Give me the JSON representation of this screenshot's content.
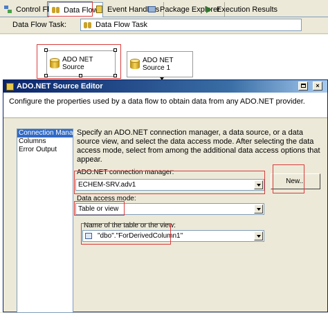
{
  "designer_tabs": [
    {
      "label": "Control Flow",
      "icon": "control-flow-icon"
    },
    {
      "label": "Data Flow",
      "icon": "data-flow-icon",
      "active": true
    },
    {
      "label": "Event Handlers",
      "icon": "event-handlers-icon"
    },
    {
      "label": "Package Explorer",
      "icon": "package-explorer-icon"
    },
    {
      "label": "Execution Results",
      "icon": "execution-results-icon"
    }
  ],
  "task": {
    "label": "Data Flow Task:",
    "selected": "Data Flow Task"
  },
  "components": [
    {
      "line1": "ADO NET",
      "line2": "Source"
    },
    {
      "line1": "ADO NET",
      "line2": "Source 1"
    }
  ],
  "dialog": {
    "title": "ADO.NET Source Editor",
    "description": "Configure the properties used by a data flow to obtain data from any ADO.NET provider.",
    "nav_items": [
      "Connection Manager",
      "Columns",
      "Error Output"
    ],
    "selected_nav": "Connection Manager",
    "instructions": "Specify an ADO.NET connection manager, a data source, or a data source view, and select the data access mode. After selecting the data access mode, select from among the additional data access options that appear.",
    "connection_manager": {
      "label": "ADO.NET connection manager:",
      "value": "ECHEM-SRV.adv1"
    },
    "new_button": "New...",
    "access_mode": {
      "label": "Data access mode:",
      "value": "Table or view"
    },
    "table": {
      "label": "Name of the table or the view:",
      "value": "\"dbo\".\"ForDerivedColumn1\""
    }
  },
  "colors": {
    "highlight": "#d83c3c",
    "selection": "#316ac5",
    "titlebar": "#0a246a"
  }
}
